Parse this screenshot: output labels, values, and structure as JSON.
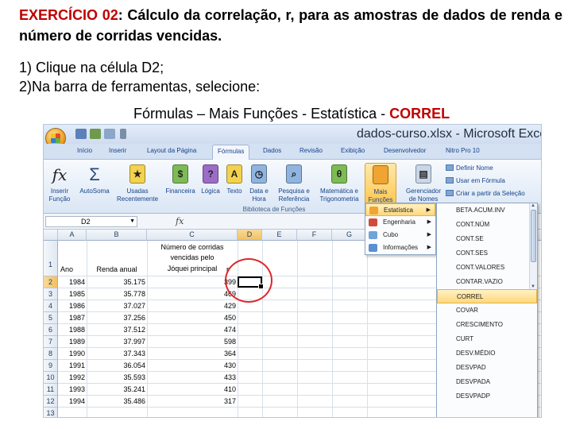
{
  "slide": {
    "heading_ex": "EXERCÍCIO 02",
    "heading_rest": ": Cálculo da correlação, r, para as amostras de dados de renda e número de corridas vencidas.",
    "step1": "1) Clique na célula D2;",
    "step2": "2)Na barra de ferramentas, selecione:",
    "step3_pre": "Fórmulas – Mais Funções - Estatística - ",
    "step3_hl": "CORREL"
  },
  "window": {
    "title": "dados-curso.xlsx - Microsoft Excel"
  },
  "tabs": [
    "Início",
    "Inserir",
    "Layout da Página",
    "Fórmulas",
    "Dados",
    "Revisão",
    "Exibição",
    "Desenvolvedor",
    "Nitro Pro 10"
  ],
  "active_tab": "Fórmulas",
  "ribbon": {
    "buttons": [
      {
        "label": "Inserir\nFunção",
        "glyph": "fx"
      },
      {
        "label": "AutoSoma",
        "glyph": "Σ"
      },
      {
        "label": "Usadas\nRecentemente",
        "glyph": "★"
      },
      {
        "label": "Financeira",
        "glyph": "$"
      },
      {
        "label": "Lógica",
        "glyph": "?"
      },
      {
        "label": "Texto",
        "glyph": "A"
      },
      {
        "label": "Data e\nHora",
        "glyph": "◷"
      },
      {
        "label": "Pesquisa e\nReferência",
        "glyph": "⌕"
      },
      {
        "label": "Matemática e\nTrigonometria",
        "glyph": "θ"
      },
      {
        "label": "Mais\nFunções",
        "glyph": ""
      },
      {
        "label": "Gerenciador\nde Nomes",
        "glyph": "▤"
      }
    ],
    "group_label": "Biblioteca de Funções",
    "right_items": [
      "Definir Nome",
      "Usar em Fórmula",
      "Criar a partir da Seleção"
    ],
    "colors": {
      "icon_yellow": "#f3d24e",
      "icon_purple": "#9c6cc7",
      "icon_green": "#7dbb54",
      "icon_orange": "#f0a432",
      "accent_red": "#c00000"
    }
  },
  "formula_bar": {
    "name_box": "D2",
    "fx": "fx"
  },
  "columns": [
    "A",
    "B",
    "C",
    "D",
    "E",
    "F",
    "G"
  ],
  "rows": [
    "1",
    "2",
    "3",
    "4",
    "5",
    "6",
    "7",
    "8",
    "9",
    "10",
    "11",
    "12",
    "13"
  ],
  "sheet": {
    "header_c_lines": [
      "Número de corridas",
      "vencidas pelo",
      "Jóquei principal"
    ],
    "header_a": "Ano",
    "header_b": "Renda anual",
    "header_d": "r",
    "data": [
      [
        "1984",
        "35.175",
        "399"
      ],
      [
        "1985",
        "35.778",
        "469"
      ],
      [
        "1986",
        "37.027",
        "429"
      ],
      [
        "1987",
        "37.256",
        "450"
      ],
      [
        "1988",
        "37.512",
        "474"
      ],
      [
        "1989",
        "37.997",
        "598"
      ],
      [
        "1990",
        "37.343",
        "364"
      ],
      [
        "1991",
        "36.054",
        "430"
      ],
      [
        "1992",
        "35.593",
        "433"
      ],
      [
        "1993",
        "35.241",
        "410"
      ],
      [
        "1994",
        "35.486",
        "317"
      ]
    ]
  },
  "menu_mais_funcoes": [
    "Estatística",
    "Engenharia",
    "Cubo",
    "Informações"
  ],
  "menu_estatistica": [
    "BETA.ACUM.INV",
    "CONT.NÚM",
    "CONT.SE",
    "CONT.SES",
    "CONT.VALORES",
    "CONTAR.VAZIO",
    "CORREL",
    "COVAR",
    "CRESCIMENTO",
    "CURT",
    "DESV.MÉDIO",
    "DESVPAD",
    "DESVPADA",
    "DESVPADP"
  ]
}
